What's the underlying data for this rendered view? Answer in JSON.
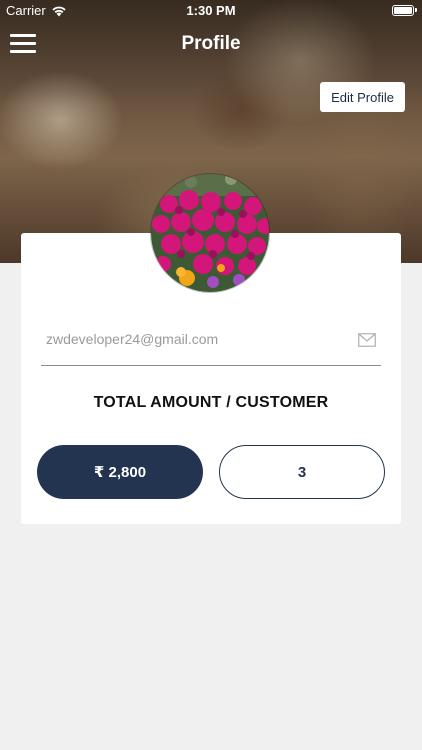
{
  "status_bar": {
    "carrier": "Carrier",
    "time": "1:30 PM",
    "wifi_icon": "wifi-icon",
    "battery_icon": "battery-icon"
  },
  "nav": {
    "title": "Profile",
    "menu_icon": "hamburger-menu-icon"
  },
  "edit_profile": {
    "label": "Edit Profile"
  },
  "profile": {
    "avatar": "flower-photo-avatar",
    "email": "zwdeveloper24@gmail.com",
    "email_icon": "mail-icon"
  },
  "summary": {
    "heading": "TOTAL AMOUNT / CUSTOMER",
    "amount": "₹ 2,800",
    "customers": "3"
  },
  "colors": {
    "accent": "#22344f",
    "background": "#f0f0f0",
    "card": "#ffffff"
  }
}
